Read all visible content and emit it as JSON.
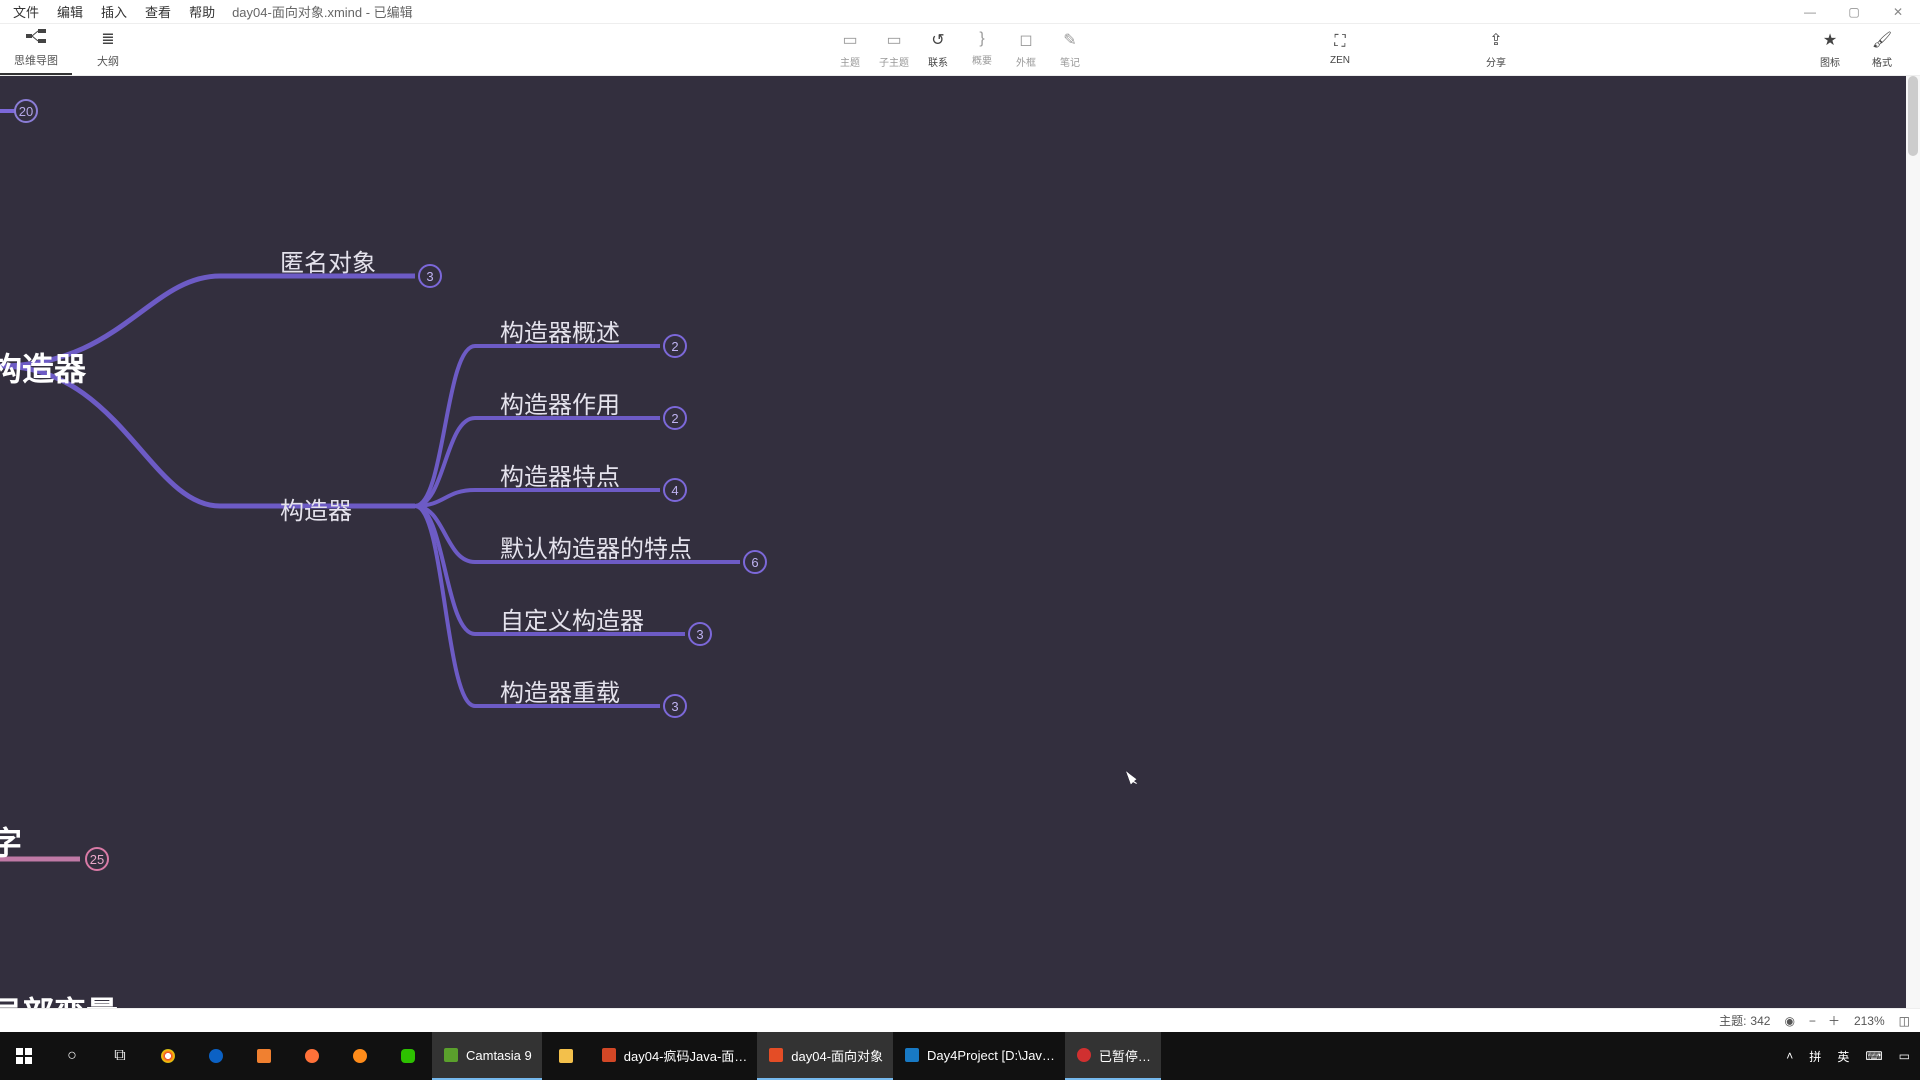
{
  "menu": {
    "file": "文件",
    "edit": "编辑",
    "insert": "插入",
    "view": "查看",
    "help": "帮助",
    "title": "day04-面向对象.xmind - 已编辑"
  },
  "window_controls": {
    "min_icon": "—",
    "max_icon": "▢",
    "close_icon": "✕"
  },
  "left_tabs": {
    "mindmap": "思维导图",
    "outline": "大纲"
  },
  "center_toolbar": {
    "topic": "主题",
    "subtopic": "子主题",
    "relation": "联系",
    "summary": "概要",
    "boundary": "外框",
    "marker": "笔记"
  },
  "right_toolbar": {
    "zen": "ZEN",
    "share": "分享",
    "iconset": "图标",
    "format": "格式"
  },
  "mind": {
    "top_badge": "20",
    "pink_badge": "25",
    "root1": "构造器",
    "root2": "字",
    "root3": "局部变量",
    "anon_object": "匿名对象",
    "anon_badge": "3",
    "constructor": "构造器",
    "children": [
      {
        "label": "构造器概述",
        "badge": "2"
      },
      {
        "label": "构造器作用",
        "badge": "2"
      },
      {
        "label": "构造器特点",
        "badge": "4"
      },
      {
        "label": "默认构造器的特点",
        "badge": "6"
      },
      {
        "label": "自定义构造器",
        "badge": "3"
      },
      {
        "label": "构造器重载",
        "badge": "3"
      }
    ]
  },
  "status": {
    "topics_label": "主题:",
    "topics_count": "342",
    "zoom": "213%"
  },
  "taskbar": {
    "camtasia": "Camtasia 9",
    "ppt": "day04-疯码Java-面…",
    "xmind": "day04-面向对象",
    "idea": "Day4Project [D:\\Jav…",
    "paused": "已暂停…"
  },
  "tray": {
    "ime1": "拼",
    "ime2": "英",
    "kbd": "⌨"
  }
}
